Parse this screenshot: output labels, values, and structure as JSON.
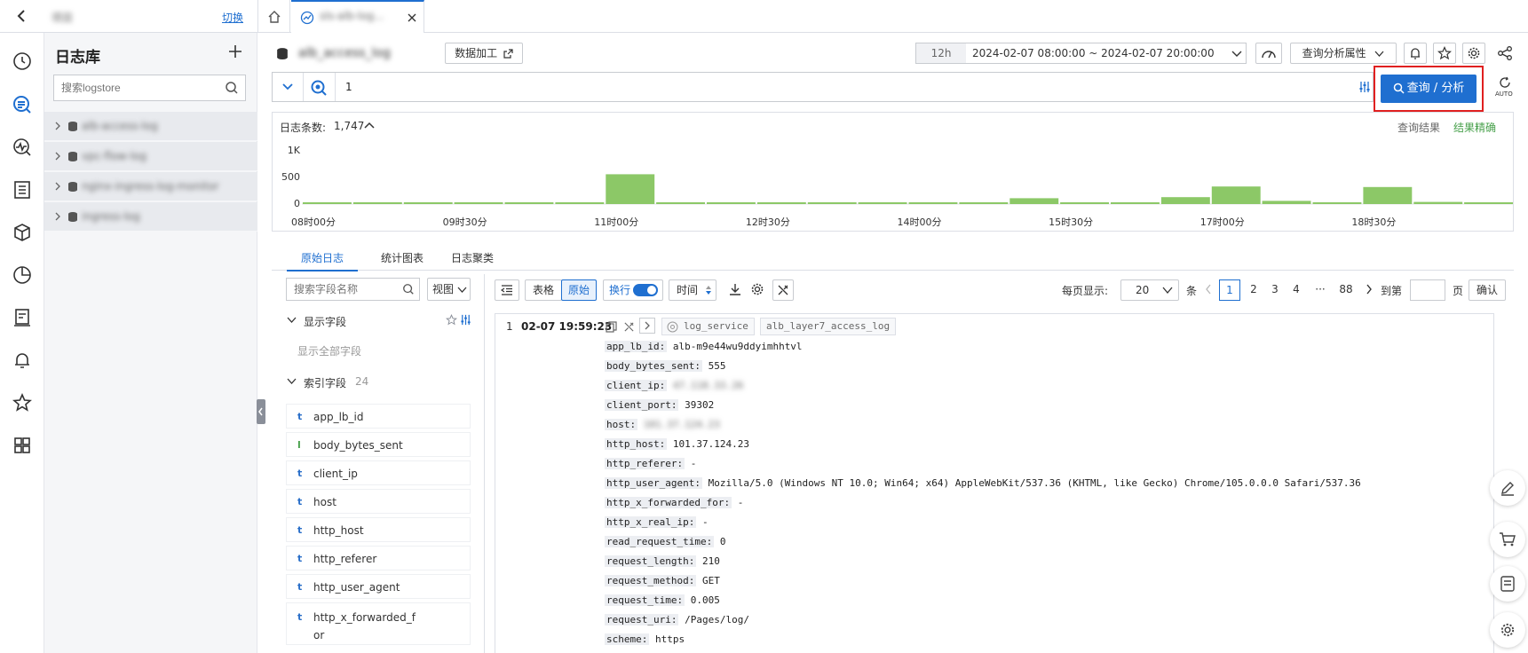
{
  "top_tabs": {
    "project_name": "项目",
    "switch_label": "切换",
    "active_tab_label": "sls-alb-log..."
  },
  "sidebar": {
    "title": "日志库",
    "search_placeholder": "搜索logstore",
    "items": [
      {
        "label": "alb-access-log"
      },
      {
        "label": "vpc-flow-log"
      },
      {
        "label": "nginx-ingress-log-monitor"
      },
      {
        "label": "ingress-log"
      }
    ]
  },
  "header": {
    "logstore_name": "alb_access_log",
    "data_process_label": "数据加工",
    "time_quick": "12h",
    "time_range": "2024-02-07 08:00:00 ~ 2024-02-07 20:00:00",
    "query_props_label": "查询分析属性"
  },
  "query": {
    "text": "1",
    "search_button": "查询 / 分析",
    "auto_label": "AUTO"
  },
  "histogram": {
    "count_label": "日志条数:",
    "count_value": "1,747",
    "result_label": "查询结果",
    "accuracy_label": "结果精确",
    "accent_color": "#8cc867"
  },
  "chart_data": {
    "type": "bar",
    "categories": [
      "08:00",
      "08:30",
      "09:00",
      "09:30",
      "10:00",
      "10:30",
      "11:00",
      "11:30",
      "12:00",
      "12:30",
      "13:00",
      "13:30",
      "14:00",
      "14:30",
      "15:00",
      "15:30",
      "16:00",
      "16:30",
      "17:00",
      "17:30",
      "18:00",
      "18:30",
      "19:00",
      "19:30"
    ],
    "values": [
      5,
      5,
      5,
      5,
      5,
      5,
      560,
      5,
      5,
      5,
      5,
      5,
      5,
      5,
      110,
      5,
      5,
      130,
      330,
      60,
      5,
      320,
      40,
      10
    ],
    "ylim": [
      0,
      1000
    ],
    "yticks": [
      "1K",
      "500",
      "0"
    ],
    "xticks": [
      "08时00分",
      "09时30分",
      "11时00分",
      "12时30分",
      "14时00分",
      "15时30分",
      "17时00分",
      "18时30分"
    ]
  },
  "tabs": [
    "原始日志",
    "统计图表",
    "日志聚类"
  ],
  "fields_panel": {
    "search_placeholder": "搜索字段名称",
    "view_label": "视图",
    "display_fields_label": "显示字段",
    "show_all_label": "显示全部字段",
    "index_fields_label": "索引字段",
    "index_count": "24",
    "fields": [
      {
        "type": "t",
        "name": "app_lb_id"
      },
      {
        "type": "l",
        "name": "body_bytes_sent"
      },
      {
        "type": "t",
        "name": "client_ip"
      },
      {
        "type": "t",
        "name": "host"
      },
      {
        "type": "t",
        "name": "http_host"
      },
      {
        "type": "t",
        "name": "http_referer"
      },
      {
        "type": "t",
        "name": "http_user_agent"
      },
      {
        "type": "t",
        "name": "http_x_forwarded_f"
      }
    ],
    "field_wrap": "or"
  },
  "toolbar": {
    "table_label": "表格",
    "raw_label": "原始",
    "wrap_label": "换行",
    "time_label": "时间",
    "per_page_label": "每页显示:",
    "per_page_value": "20",
    "unit_label": "条",
    "pages": [
      "1",
      "2",
      "3",
      "4",
      "···",
      "88"
    ],
    "goto_label": "到第",
    "page_unit": "页",
    "confirm_label": "确认"
  },
  "log_entry": {
    "index": "1",
    "time": "02-07 19:59:23",
    "tag1": "log_service",
    "tag2": "alb_layer7_access_log",
    "fields": [
      {
        "k": "app_lb_id:",
        "v": "alb-m9e44wu9ddyimhhtvl"
      },
      {
        "k": "body_bytes_sent:",
        "v": "555"
      },
      {
        "k": "client_ip:",
        "v": "47.118.33.26"
      },
      {
        "k": "client_port:",
        "v": "39302"
      },
      {
        "k": "host:",
        "v": "101.37.124.23"
      },
      {
        "k": "http_host:",
        "v": "101.37.124.23"
      },
      {
        "k": "http_referer:",
        "v": "-"
      },
      {
        "k": "http_user_agent:",
        "v": "Mozilla/5.0 (Windows NT 10.0; Win64; x64) AppleWebKit/537.36 (KHTML, like Gecko) Chrome/105.0.0.0 Safari/537.36"
      },
      {
        "k": "http_x_forwarded_for:",
        "v": "-"
      },
      {
        "k": "http_x_real_ip:",
        "v": "-"
      },
      {
        "k": "read_request_time:",
        "v": "0"
      },
      {
        "k": "request_length:",
        "v": "210"
      },
      {
        "k": "request_method:",
        "v": "GET"
      },
      {
        "k": "request_time:",
        "v": "0.005"
      },
      {
        "k": "request_uri:",
        "v": "/Pages/log/"
      },
      {
        "k": "scheme:",
        "v": "https"
      }
    ]
  }
}
